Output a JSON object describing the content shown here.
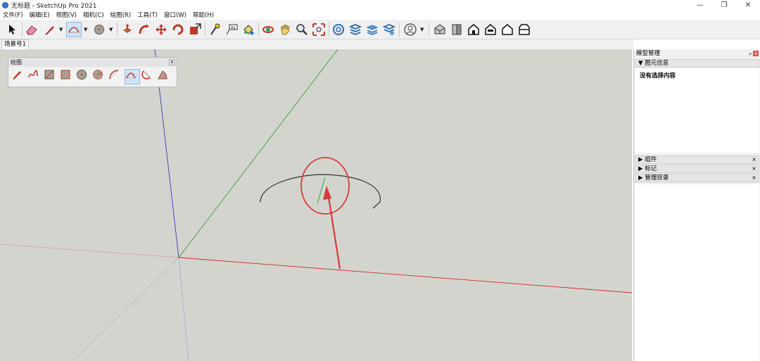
{
  "window": {
    "title": "无标题 - SketchUp Pro 2021",
    "minimize": "—",
    "maximize": "❐",
    "close": "✕"
  },
  "menu": [
    "文件(F)",
    "编辑(E)",
    "视图(V)",
    "相机(C)",
    "绘图(R)",
    "工具(T)",
    "窗口(W)",
    "帮助(H)"
  ],
  "toolbar": {
    "icons": [
      "select-arrow",
      "eraser",
      "pencil",
      "arc-2point",
      "circle",
      "paint-bucket",
      "push-pull",
      "move",
      "rotate",
      "scale",
      "tape-measure",
      "text",
      "paint",
      "orbit",
      "pan",
      "zoom",
      "zoom-extents",
      "warehouse",
      "layers",
      "sandbox",
      "styles",
      "user",
      "house-1",
      "house-2",
      "house-3",
      "house-4",
      "house-5",
      "house-6"
    ],
    "active_tool": "arc-2point"
  },
  "scene_tab": "场景号1",
  "draw_panel": {
    "title": "绘图",
    "close": "x",
    "tools": [
      "line",
      "freehand",
      "rectangle",
      "rotated-rectangle",
      "circle",
      "polygon",
      "arc",
      "arc-2point",
      "arc-3point",
      "pie"
    ],
    "active_tool": "arc-2point"
  },
  "tray": {
    "title": "模型管理",
    "pin": "ᵖ",
    "close": "x",
    "entity_info": {
      "label": "▼ 图元信息",
      "content": "没有选择内容"
    },
    "panels": [
      {
        "label": "▶ 组件",
        "close": "×"
      },
      {
        "label": "▶ 标记",
        "close": "×"
      },
      {
        "label": "▶ 管理目录",
        "close": "×"
      }
    ]
  },
  "colors": {
    "viewport_bg": "#d4d4cf",
    "red_axis": "#cc2a2a",
    "green_axis": "#33a033",
    "blue_axis": "#3a3ab0",
    "annotation": "#d83a3a",
    "accent": "#cfe3f7"
  }
}
